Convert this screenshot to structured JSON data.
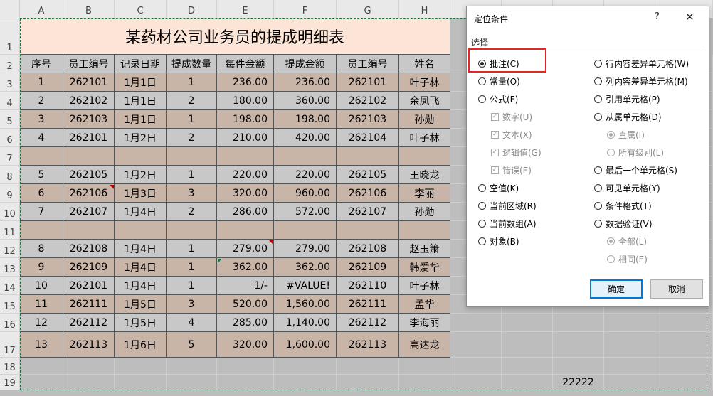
{
  "sheet": {
    "columns": [
      "A",
      "B",
      "C",
      "D",
      "E",
      "F",
      "G",
      "H",
      "",
      "",
      "",
      "",
      ""
    ],
    "rows": [
      "1",
      "2",
      "3",
      "4",
      "5",
      "6",
      "7",
      "8",
      "9",
      "10",
      "11",
      "12",
      "13",
      "14",
      "15",
      "16",
      "17",
      "18",
      "19"
    ],
    "title": "某药材公司业务员的提成明细表",
    "headers": [
      "序号",
      "员工编号",
      "记录日期",
      "提成数量",
      "每件金额",
      "提成金额",
      "员工编号",
      "姓名"
    ],
    "data": [
      [
        "1",
        "262101",
        "1月1日",
        "1",
        "236.00",
        "236.00",
        "262101",
        "叶子林"
      ],
      [
        "2",
        "262102",
        "1月1日",
        "2",
        "180.00",
        "360.00",
        "262102",
        "余凤飞"
      ],
      [
        "3",
        "262103",
        "1月1日",
        "1",
        "198.00",
        "198.00",
        "262103",
        "孙勋"
      ],
      [
        "4",
        "262101",
        "1月2日",
        "2",
        "210.00",
        "420.00",
        "262104",
        "叶子林"
      ],
      [
        "",
        "",
        "",
        "",
        "",
        "",
        "",
        ""
      ],
      [
        "5",
        "262105",
        "1月2日",
        "1",
        "220.00",
        "220.00",
        "262105",
        "王晓龙"
      ],
      [
        "6",
        "262106",
        "1月3日",
        "3",
        "320.00",
        "960.00",
        "262106",
        "李丽"
      ],
      [
        "7",
        "262107",
        "1月4日",
        "2",
        "286.00",
        "572.00",
        "262107",
        "孙勋"
      ],
      [
        "",
        "",
        "",
        "",
        "",
        "",
        "",
        ""
      ],
      [
        "8",
        "262108",
        "1月4日",
        "1",
        "279.00",
        "279.00",
        "262108",
        "赵玉箫"
      ],
      [
        "9",
        "262109",
        "1月4日",
        "1",
        "362.00",
        "362.00",
        "262109",
        "韩爱华"
      ],
      [
        "10",
        "262101",
        "1月4日",
        "1",
        "1/-",
        "#VALUE!",
        "262110",
        "叶子林"
      ],
      [
        "11",
        "262111",
        "1月5日",
        "3",
        "520.00",
        "1,560.00",
        "262111",
        "孟华"
      ],
      [
        "12",
        "262112",
        "1月5日",
        "4",
        "285.00",
        "1,140.00",
        "262112",
        "李海丽"
      ],
      [
        "13",
        "262113",
        "1月6日",
        "5",
        "320.00",
        "1,600.00",
        "262113",
        "高达龙"
      ]
    ],
    "extra_value": "22222",
    "colors": {
      "title_bg": "#fce4d6",
      "row_tan": "#c9b5a8",
      "row_gray": "#c8c8c8",
      "header_bg": "#c8c8c8",
      "outside_bg": "#bdbdbd",
      "selection": "#217346"
    }
  },
  "dialog": {
    "title": "定位条件",
    "help": "?",
    "close_icon": "close-icon",
    "group": "选择",
    "left_options": [
      {
        "label": "批注(C)",
        "selected": true,
        "type": "radio",
        "disabled": false
      },
      {
        "label": "常量(O)",
        "selected": false,
        "type": "radio",
        "disabled": false
      },
      {
        "label": "公式(F)",
        "selected": false,
        "type": "radio",
        "disabled": false
      },
      {
        "label": "数字(U)",
        "selected": true,
        "type": "check",
        "disabled": true
      },
      {
        "label": "文本(X)",
        "selected": true,
        "type": "check",
        "disabled": true
      },
      {
        "label": "逻辑值(G)",
        "selected": true,
        "type": "check",
        "disabled": true
      },
      {
        "label": "错误(E)",
        "selected": true,
        "type": "check",
        "disabled": true
      },
      {
        "label": "空值(K)",
        "selected": false,
        "type": "radio",
        "disabled": false
      },
      {
        "label": "当前区域(R)",
        "selected": false,
        "type": "radio",
        "disabled": false
      },
      {
        "label": "当前数组(A)",
        "selected": false,
        "type": "radio",
        "disabled": false
      },
      {
        "label": "对象(B)",
        "selected": false,
        "type": "radio",
        "disabled": false
      }
    ],
    "right_options": [
      {
        "label": "行内容差异单元格(W)",
        "selected": false,
        "type": "radio",
        "disabled": false
      },
      {
        "label": "列内容差异单元格(M)",
        "selected": false,
        "type": "radio",
        "disabled": false
      },
      {
        "label": "引用单元格(P)",
        "selected": false,
        "type": "radio",
        "disabled": false
      },
      {
        "label": "从属单元格(D)",
        "selected": false,
        "type": "radio",
        "disabled": false
      },
      {
        "label": "直属(I)",
        "selected": true,
        "type": "radio",
        "disabled": true
      },
      {
        "label": "所有级别(L)",
        "selected": false,
        "type": "radio",
        "disabled": true
      },
      {
        "label": "最后一个单元格(S)",
        "selected": false,
        "type": "radio",
        "disabled": false
      },
      {
        "label": "可见单元格(Y)",
        "selected": false,
        "type": "radio",
        "disabled": false
      },
      {
        "label": "条件格式(T)",
        "selected": false,
        "type": "radio",
        "disabled": false
      },
      {
        "label": "数据验证(V)",
        "selected": false,
        "type": "radio",
        "disabled": false
      },
      {
        "label": "全部(L)",
        "selected": true,
        "type": "radio",
        "disabled": true
      },
      {
        "label": "相同(E)",
        "selected": false,
        "type": "radio",
        "disabled": true
      }
    ],
    "ok_label": "确定",
    "cancel_label": "取消",
    "highlight_color": "#e3262b"
  }
}
